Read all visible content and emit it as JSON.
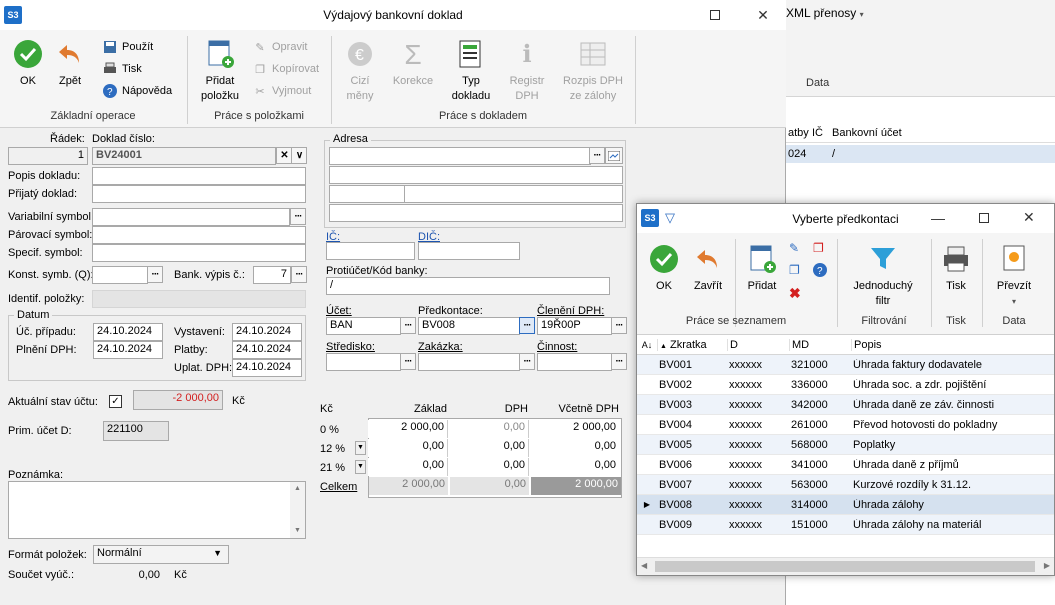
{
  "bg": {
    "xml": "XML přenosy",
    "data_group": "Data",
    "col_platby": "atby",
    "col_ic": "IČ",
    "col_bank": "Bankovní účet",
    "row_id": "024",
    "row_bank": "/"
  },
  "dialog": {
    "logo": "S3",
    "title": "Výdajový bankovní doklad"
  },
  "ribbon": {
    "ok": "OK",
    "back": "Zpět",
    "use": "Použít",
    "print": "Tisk",
    "help": "Nápověda",
    "group_basic": "Základní operace",
    "add_item": "Přidat\npoložku",
    "edit": "Opravit",
    "copy": "Kopírovat",
    "cut": "Vyjmout",
    "group_items": "Práce s položkami",
    "foreign": "Cizí\nměny",
    "correction": "Korekce",
    "doc_type": "Typ\ndokladu",
    "vat_reg": "Registr\nDPH",
    "vat_split": "Rozpis DPH\nze zálohy",
    "group_doc": "Práce s dokladem"
  },
  "form": {
    "row_label": "Řádek:",
    "row_value": "1",
    "doc_no_label": "Doklad číslo:",
    "doc_no": "BV24001",
    "desc_label": "Popis dokladu:",
    "received_label": "Přijatý doklad:",
    "var_sym": "Variabilní symbol:",
    "pair_sym": "Párovací symbol:",
    "spec_sym": "Specif. symbol:",
    "const_sym": "Konst. symb. (Q):",
    "bank_stmt": "Bank. výpis č.:",
    "bank_stmt_val": "7",
    "ident": "Identif. položky:",
    "dates_title": "Datum",
    "acc_case": "Úč. případu:",
    "acc_case_val": "24.10.2024",
    "vat_date": "Plnění DPH:",
    "vat_date_val": "24.10.2024",
    "issued": "Vystavení:",
    "issued_val": "24.10.2024",
    "payment": "Platby:",
    "payment_val": "24.10.2024",
    "vat_app": "Uplat. DPH:",
    "vat_app_val": "24.10.2024",
    "balance_label": "Aktuální stav účtu:",
    "balance_val": "-2 000,00",
    "currency": "Kč",
    "prim_acc": "Prim. účet D:",
    "prim_acc_val": "221100",
    "note": "Poznámka:",
    "item_fmt": "Formát položek:",
    "item_fmt_val": "Normální",
    "sum_label": "Součet vyúč.:",
    "sum_val": "0,00",
    "sum_cur": "Kč",
    "address": "Adresa",
    "ic": "IČ:",
    "dic": "DIČ:",
    "counter_acc": "Protiúčet/Kód banky:",
    "counter_acc_val": "/",
    "account": "Účet:",
    "account_val": "BAN",
    "precont": "Předkontace:",
    "precont_val": "BV008",
    "vat_class": "Členění DPH:",
    "vat_class_val": "19Ř00P",
    "center": "Středisko:",
    "order": "Zakázka:",
    "activity": "Činnost:"
  },
  "vat_table": {
    "h_cur": "Kč",
    "h_base": "Základ",
    "h_vat": "DPH",
    "h_incl": "Včetně DPH",
    "rows": [
      {
        "rate": "0 %",
        "base": "2 000,00",
        "vat": "0,00",
        "incl": "2 000,00"
      },
      {
        "rate": "12 %",
        "base": "0,00",
        "vat": "0,00",
        "incl": "0,00"
      },
      {
        "rate": "21 %",
        "base": "0,00",
        "vat": "0,00",
        "incl": "0,00"
      }
    ],
    "total": {
      "rate": "Celkem",
      "base": "2 000,00",
      "vat": "0,00",
      "incl": "2 000,00"
    }
  },
  "popup": {
    "logo": "S3",
    "title": "Vyberte předkontaci",
    "ok": "OK",
    "close": "Zavřít",
    "add": "Přidat",
    "group_list": "Práce se seznamem",
    "filter": "Jednoduchý\nfiltr",
    "group_filter": "Filtrování",
    "print": "Tisk",
    "group_print": "Tisk",
    "take": "Převzít",
    "group_data": "Data",
    "headers": [
      "Zkratka",
      "D",
      "MD",
      "Popis"
    ],
    "rows": [
      {
        "code": "BV001",
        "d": "xxxxxx",
        "md": "321000",
        "desc": "Úhrada faktury dodavatele"
      },
      {
        "code": "BV002",
        "d": "xxxxxx",
        "md": "336000",
        "desc": "Úhrada soc. a zdr. pojištění"
      },
      {
        "code": "BV003",
        "d": "xxxxxx",
        "md": "342000",
        "desc": "Úhrada daně ze záv. činnosti"
      },
      {
        "code": "BV004",
        "d": "xxxxxx",
        "md": "261000",
        "desc": "Převod hotovosti do pokladny"
      },
      {
        "code": "BV005",
        "d": "xxxxxx",
        "md": "568000",
        "desc": "Poplatky"
      },
      {
        "code": "BV006",
        "d": "xxxxxx",
        "md": "341000",
        "desc": "Úhrada daně z příjmů"
      },
      {
        "code": "BV007",
        "d": "xxxxxx",
        "md": "563000",
        "desc": "Kurzové rozdíly k 31.12."
      },
      {
        "code": "BV008",
        "d": "xxxxxx",
        "md": "314000",
        "desc": "Úhrada zálohy"
      },
      {
        "code": "BV009",
        "d": "xxxxxx",
        "md": "151000",
        "desc": "Úhrada zálohy na materiál"
      }
    ],
    "selected_index": 7
  },
  "colors": {
    "accent": "#1e6fc8",
    "ok_green": "#3aa63a",
    "back_orange": "#e07a2f",
    "selected_row": "#d5e1ef",
    "alt_row": "#eef3fa"
  }
}
